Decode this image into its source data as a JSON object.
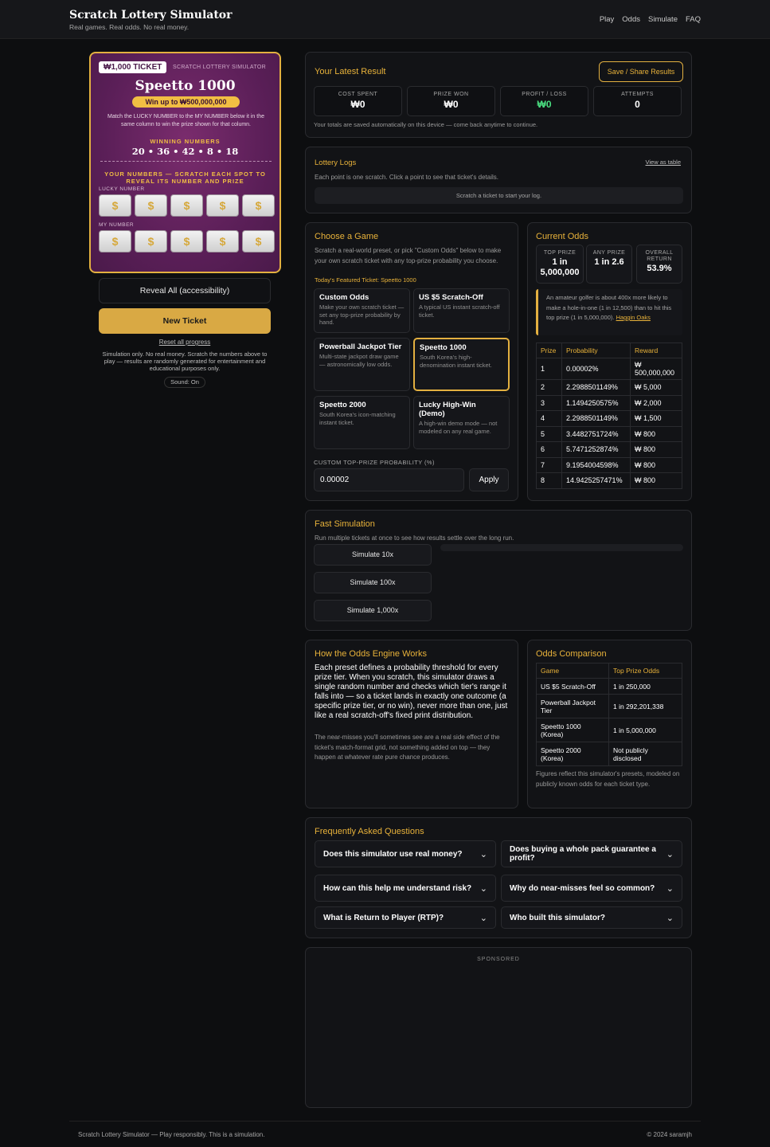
{
  "header": {
    "title": "Scratch Lottery Simulator",
    "tagline": "Real games. Real odds. No real money.",
    "nav": [
      "Play",
      "Odds",
      "Simulate",
      "FAQ"
    ]
  },
  "ticket": {
    "badge": "₩1,000 TICKET",
    "sub": "SCRATCH LOTTERY SIMULATOR",
    "name": "Speetto 1000",
    "prize": "Win up to ₩500,000,000",
    "instructions": "Match the LUCKY NUMBER to the MY NUMBER below it in the same column to win the prize shown for that column.",
    "winning_label": "WINNING NUMBERS",
    "winning_numbers": "20 • 36 • 42 • 8 • 18",
    "your_numbers": "YOUR NUMBERS — SCRATCH EACH SPOT TO REVEAL ITS NUMBER AND PRIZE",
    "lucky_label": "LUCKY NUMBER",
    "my_label": "MY NUMBER",
    "spot": "$"
  },
  "controls": {
    "reveal": "Reveal All (accessibility)",
    "new_ticket": "New Ticket",
    "reset": "Reset all progress",
    "disclaimer": "Simulation only. No real money. Scratch the numbers above to play — results are randomly generated for entertainment and educational purposes only.",
    "sound": "Sound: On"
  },
  "result": {
    "title": "Your Latest Result",
    "share": "Save / Share Results",
    "stats": [
      {
        "label": "COST SPENT",
        "value": "₩0"
      },
      {
        "label": "PRIZE WON",
        "value": "₩0"
      },
      {
        "label": "PROFIT / LOSS",
        "value": "₩0"
      },
      {
        "label": "ATTEMPTS",
        "value": "0"
      }
    ],
    "note": "Your totals are saved automatically on this device — come back anytime to continue."
  },
  "logs": {
    "title": "Lottery Logs",
    "view_table": "View as table",
    "desc": "Each point is one scratch. Click a point to see that ticket's details.",
    "empty": "Scratch a ticket to start your log."
  },
  "choose": {
    "title": "Choose a Game",
    "desc": "Scratch a real-world preset, or pick \"Custom Odds\" below to make your own scratch ticket with any top-prize probability you choose.",
    "featured": "Today's Featured Ticket: Speetto 1000",
    "games": [
      {
        "name": "Custom Odds",
        "desc": "Make your own scratch ticket — set any top-prize probability by hand."
      },
      {
        "name": "US $5 Scratch-Off",
        "desc": "A typical US instant scratch-off ticket."
      },
      {
        "name": "Powerball Jackpot Tier",
        "desc": "Multi-state jackpot draw game — astronomically low odds."
      },
      {
        "name": "Speetto 1000",
        "desc": "South Korea's high-denomination instant ticket."
      },
      {
        "name": "Speetto 2000",
        "desc": "South Korea's icon-matching instant ticket."
      },
      {
        "name": "Lucky High-Win (Demo)",
        "desc": "A high-win demo mode — not modeled on any real game."
      }
    ],
    "custom_label": "CUSTOM TOP-PRIZE PROBABILITY (%)",
    "custom_value": "0.00002",
    "apply": "Apply"
  },
  "odds": {
    "title": "Current Odds",
    "boxes": [
      {
        "label": "TOP PRIZE",
        "value": "1 in 5,000,000"
      },
      {
        "label": "ANY PRIZE",
        "value": "1 in 2.6"
      },
      {
        "label": "OVERALL RETURN",
        "value": "53.9%"
      }
    ],
    "fact": "An amateur golfer is about 400x more likely to make a hole-in-one (1 in 12,500) than to hit this top prize (1 in 5,000,000).",
    "fact_link": "Haggin Oaks",
    "headers": [
      "Prize",
      "Probability",
      "Reward"
    ],
    "rows": [
      [
        "1",
        "0.00002%",
        "₩ 500,000,000"
      ],
      [
        "2",
        "2.2988501149%",
        "₩ 5,000"
      ],
      [
        "3",
        "1.14942505​75%",
        "₩ 2,000"
      ],
      [
        "4",
        "2.2988501149%",
        "₩ 1,500"
      ],
      [
        "5",
        "3.4482751724%",
        "₩ 800"
      ],
      [
        "6",
        "5.7471252874%",
        "₩ 800"
      ],
      [
        "7",
        "9.1954004598%",
        "₩ 800"
      ],
      [
        "8",
        "14.9425257471%",
        "₩ 800"
      ]
    ]
  },
  "sim": {
    "title": "Fast Simulation",
    "desc": "Run multiple tickets at once to see how results settle over the long run.",
    "buttons": [
      "Simulate 10x",
      "Simulate 100x",
      "Simulate 1,000x"
    ]
  },
  "engine": {
    "title": "How the Odds Engine Works",
    "p1": "Each preset defines a probability threshold for every prize tier. When you scratch, this simulator draws a single random number and checks which tier's range it falls into — so a ticket lands in exactly one outcome (a specific prize tier, or no win), never more than one, just like a real scratch-off's fixed print distribution.",
    "p2": "The near-misses you'll sometimes see are a real side effect of the ticket's match-format grid, not something added on top — they happen at whatever rate pure chance produces."
  },
  "comparison": {
    "title": "Odds Comparison",
    "headers": [
      "Game",
      "Top Prize Odds"
    ],
    "rows": [
      [
        "US $5 Scratch-Off",
        "1 in 250,000"
      ],
      [
        "Powerball Jackpot Tier",
        "1 in 292,201,338"
      ],
      [
        "Speetto 1000 (Korea)",
        "1 in 5,000,000"
      ],
      [
        "Speetto 2000 (Korea)",
        "Not publicly disclosed"
      ]
    ],
    "note": "Figures reflect this simulator's presets, modeled on publicly known odds for each ticket type."
  },
  "faq": {
    "title": "Frequently Asked Questions",
    "items": [
      "Does this simulator use real money?",
      "Does buying a whole pack guarantee a profit?",
      "How can this help me understand risk?",
      "Why do near-misses feel so common?",
      "What is Return to Player (RTP)?",
      "Who built this simulator?"
    ]
  },
  "sponsored": "SPONSORED",
  "footer": {
    "left": "Scratch Lottery Simulator — Play responsibly. This is a simulation.",
    "right": "© 2024 saramjh"
  },
  "colors": {
    "accent": "#e3b040",
    "profit": "#4ade80",
    "ticket": "#5b1f58"
  }
}
